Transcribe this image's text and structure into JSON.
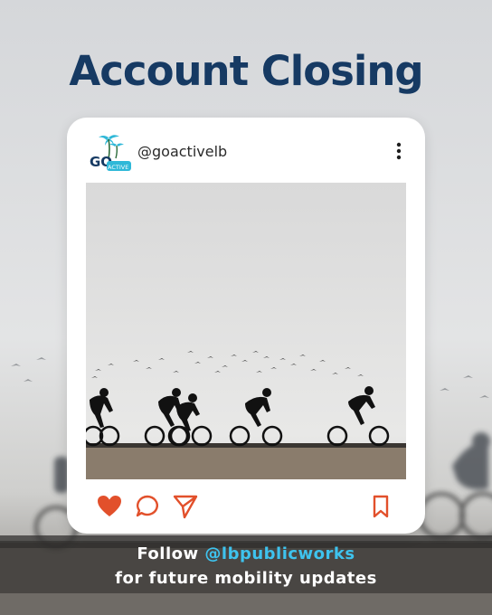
{
  "headline": "Account Closing",
  "colors": {
    "headline": "#163a63",
    "accent_blue": "#3ec3ee",
    "icon_orange": "#e2502b",
    "card": "#ffffff"
  },
  "post": {
    "avatar_text_top": "GO",
    "avatar_text_bottom": "ACTIVE LB",
    "handle": "@goactivelb",
    "more_icon": "kebab-vertical-icon",
    "action_icons": [
      "heart-icon",
      "comment-icon",
      "share-icon",
      "bookmark-icon"
    ],
    "liked": true
  },
  "footer": {
    "line1_prefix": "Follow ",
    "line1_handle": "@lbpublicworks",
    "line2": "for future mobility updates"
  }
}
